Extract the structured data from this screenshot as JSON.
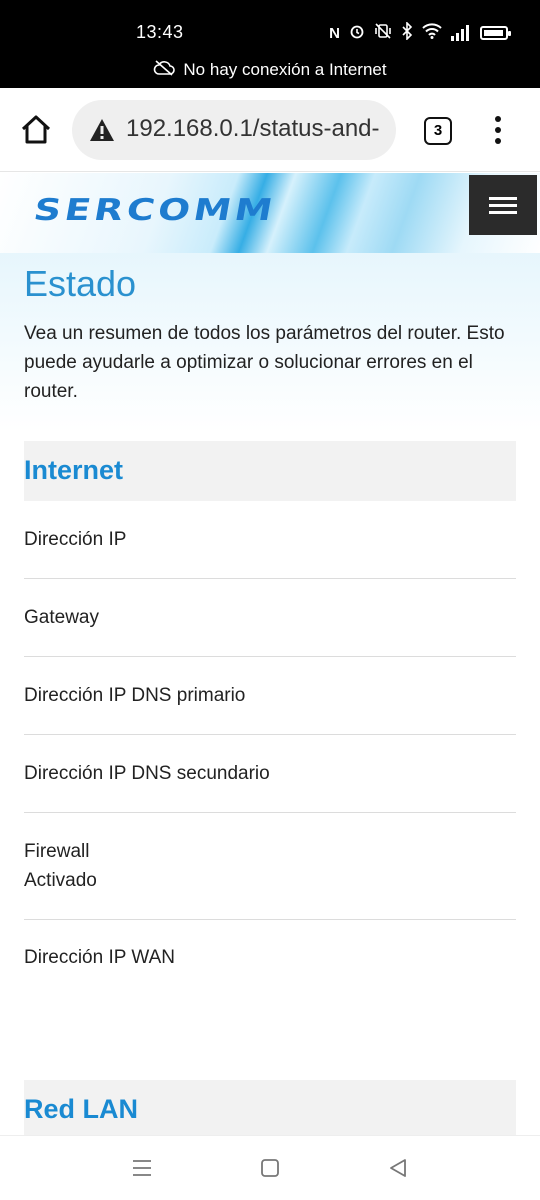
{
  "status_bar": {
    "time": "13:43",
    "icons": [
      "nfc-icon",
      "alarm-icon",
      "vibrate-off-icon",
      "bluetooth-icon",
      "wifi-icon",
      "signal-icon",
      "battery-icon"
    ],
    "offline_notice": "No hay conexión a Internet"
  },
  "browser": {
    "url": "192.168.0.1/status-and-",
    "tab_count": "3",
    "security_icon": "warning-icon"
  },
  "header": {
    "logo_text": "SERCOMM",
    "accent": "#1a8ad2"
  },
  "page": {
    "title": "Estado",
    "intro": "Vea un resumen de todos los parámetros del router. Esto puede ayudarle a optimizar o solucionar errores en el router."
  },
  "sections": [
    {
      "heading": "Internet",
      "rows": [
        {
          "label": "Dirección IP",
          "value": ""
        },
        {
          "label": "Gateway",
          "value": ""
        },
        {
          "label": "Dirección IP DNS primario",
          "value": ""
        },
        {
          "label": "Dirección IP DNS secundario",
          "value": ""
        },
        {
          "label": "Firewall",
          "value": "Activado"
        },
        {
          "label": "Dirección IP WAN",
          "value": ""
        }
      ]
    },
    {
      "heading": "Red LAN",
      "rows": []
    }
  ],
  "nav": {
    "icons": [
      "recent-apps-icon",
      "home-nav-icon",
      "back-icon"
    ]
  }
}
